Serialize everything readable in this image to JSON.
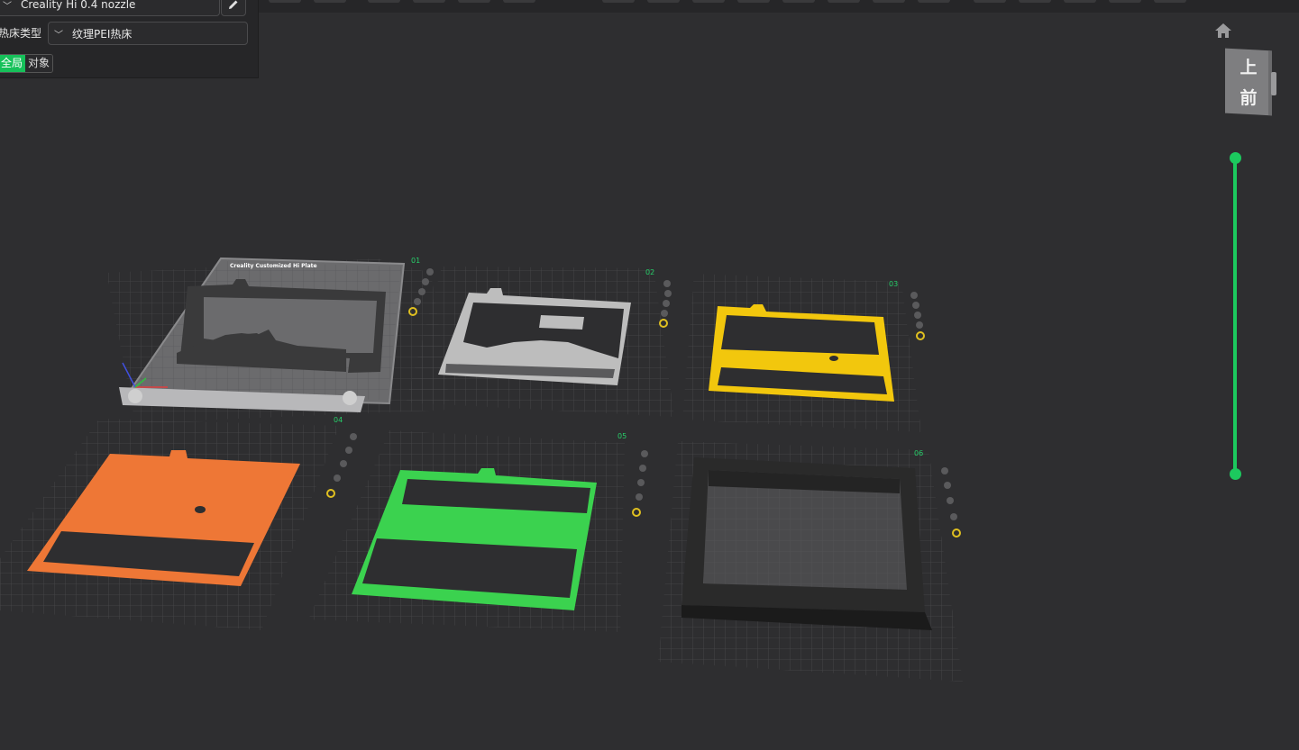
{
  "settings_panel": {
    "printer": "Creality Hi 0.4 nozzle",
    "bed_type_label": "热床类型",
    "bed_type_value": "纹理PEI热床",
    "scope_global": "全局",
    "scope_object": "对象"
  },
  "view_cube": {
    "top": "上",
    "front": "前"
  },
  "layer_slider": {
    "accent": "#1cc95e"
  },
  "plates": [
    {
      "number": "01",
      "model_color": "#3a3a3b",
      "caption": "Creality Customized Hi Plate"
    },
    {
      "number": "02",
      "model_color": "#bdbdbd"
    },
    {
      "number": "03",
      "model_color": "#f2c70d"
    },
    {
      "number": "04",
      "model_color": "#ee7736"
    },
    {
      "number": "05",
      "model_color": "#3bd24f"
    },
    {
      "number": "06",
      "model_color": "#222222"
    }
  ],
  "colors": {
    "background": "#2e2e30",
    "panel": "#262628",
    "accent_green": "#16c15a",
    "plate_number": "#27d06a"
  }
}
